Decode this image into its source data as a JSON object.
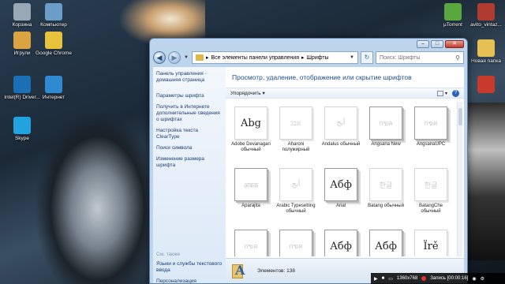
{
  "desktop": {
    "icons_left": [
      {
        "label": "Корзина",
        "color": "#9aa8b6"
      },
      {
        "label": "Компьютер",
        "color": "#6a9ec9"
      },
      {
        "label": "Игрули",
        "color": "#d9a441"
      },
      {
        "label": "Google Chrome",
        "color": "#e8c23a"
      },
      {
        "label": "Intel(R) Driver...",
        "color": "#1a6fb5"
      },
      {
        "label": "Интернет",
        "color": "#2f8ad1"
      },
      {
        "label": "Skype",
        "color": "#22a3e0"
      }
    ],
    "icons_right": [
      {
        "label": "µTorrent",
        "color": "#59a83f"
      },
      {
        "label": "avito_vintaz...",
        "color": "#b23b2f"
      },
      {
        "label": "Новая папка",
        "color": "#e6c055"
      },
      {
        "label": "",
        "color": "#c83a2c"
      }
    ]
  },
  "window": {
    "breadcrumb_root": "Все элементы панели управления",
    "breadcrumb_sep": "▸",
    "breadcrumb_current": "Шрифты",
    "search_placeholder": "Поиск: Шрифты",
    "caption_buttons": {
      "minimize": "–",
      "maximize": "□",
      "close": "✕"
    }
  },
  "left_pane": {
    "links": [
      "Панель управления - домашняя страница",
      "Параметры шрифта",
      "Получить в Интернете дополнительные сведения о шрифтах",
      "Настройка текста ClearType",
      "Поиск символа",
      "Изменение размера шрифта"
    ],
    "see_also": "См. также",
    "see_also_links": [
      "Языки и службы текстового ввода",
      "Персонализация"
    ]
  },
  "main": {
    "heading": "Просмотр, удаление, отображение или скрытие шрифтов",
    "toolbar_organize": "Упорядочить",
    "fonts": [
      {
        "name": "Adobe Devanagari обычный",
        "sample": "Abg",
        "style": "single-dark"
      },
      {
        "name": "Aharoni полужирный",
        "sample": "אבג",
        "style": "single"
      },
      {
        "name": "Andalus обычный",
        "sample": "أبج",
        "style": "single"
      },
      {
        "name": "Angsana New",
        "sample": "กขค",
        "style": "stack"
      },
      {
        "name": "AngsanaUPC",
        "sample": "กขค",
        "style": "stack"
      },
      {
        "name": "Aparajita",
        "sample": "अबक",
        "style": "stack"
      },
      {
        "name": "Arabic Typesetting обычный",
        "sample": "أبج",
        "style": "single"
      },
      {
        "name": "Arial",
        "sample": "Абф",
        "style": "stack-dark"
      },
      {
        "name": "Batang обычный",
        "sample": "한글",
        "style": "single"
      },
      {
        "name": "BatangChe обычный",
        "sample": "한글",
        "style": "single"
      },
      {
        "name": "",
        "sample": "กขค",
        "style": "stack"
      },
      {
        "name": "",
        "sample": "กขค",
        "style": "stack"
      },
      {
        "name": "",
        "sample": "Абф",
        "style": "stack-dark"
      },
      {
        "name": "",
        "sample": "Абф",
        "style": "stack-dark"
      },
      {
        "name": "",
        "sample": "Ïrě",
        "style": "single-dark"
      }
    ]
  },
  "status": {
    "items_label": "Элементов: 138"
  },
  "recording_bar": {
    "resolution": "1360x768",
    "recording": "Запись [00:00:16]"
  }
}
